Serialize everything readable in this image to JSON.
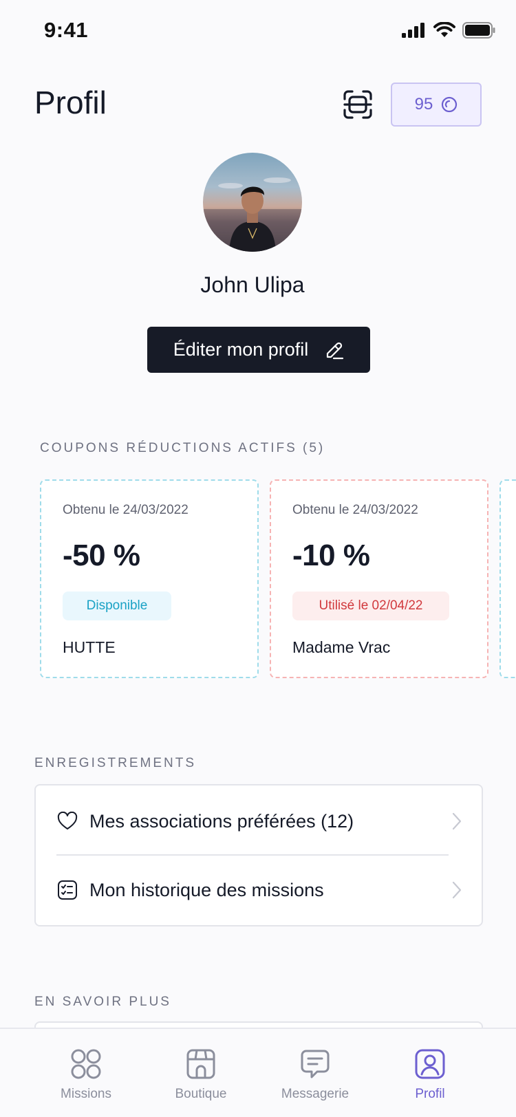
{
  "status_bar": {
    "time": "9:41"
  },
  "header": {
    "title": "Profil",
    "points": "95"
  },
  "profile": {
    "name": "John Ulipa",
    "edit_label": "Éditer mon profil"
  },
  "coupons": {
    "section_title": "COUPONS RÉDUCTIONS ACTIFS (5)",
    "items": [
      {
        "date": "Obtenu le 24/03/2022",
        "value": "-50 %",
        "status": "Disponible",
        "shop": "HUTTE",
        "status_color": "#1aa2c5"
      },
      {
        "date": "Obtenu le 24/03/2022",
        "value": "-10 %",
        "status": "Utilisé le 02/04/22",
        "shop": "Madame Vrac",
        "status_color": "#d1393d"
      }
    ]
  },
  "saved": {
    "section_title": "ENREGISTREMENTS",
    "items": [
      {
        "label": "Mes associations préférées (12)",
        "icon": "heart-icon"
      },
      {
        "label": "Mon historique des missions",
        "icon": "checklist-icon"
      }
    ]
  },
  "more": {
    "section_title": "EN SAVOIR PLUS"
  },
  "tabs": [
    {
      "label": "Missions",
      "icon": "grid-icon"
    },
    {
      "label": "Boutique",
      "icon": "shop-icon"
    },
    {
      "label": "Messagerie",
      "icon": "chat-icon"
    },
    {
      "label": "Profil",
      "icon": "profile-icon",
      "active": true
    }
  ],
  "colors": {
    "accent": "#6c5fd0",
    "dark": "#171b27",
    "background": "#fafafc"
  }
}
